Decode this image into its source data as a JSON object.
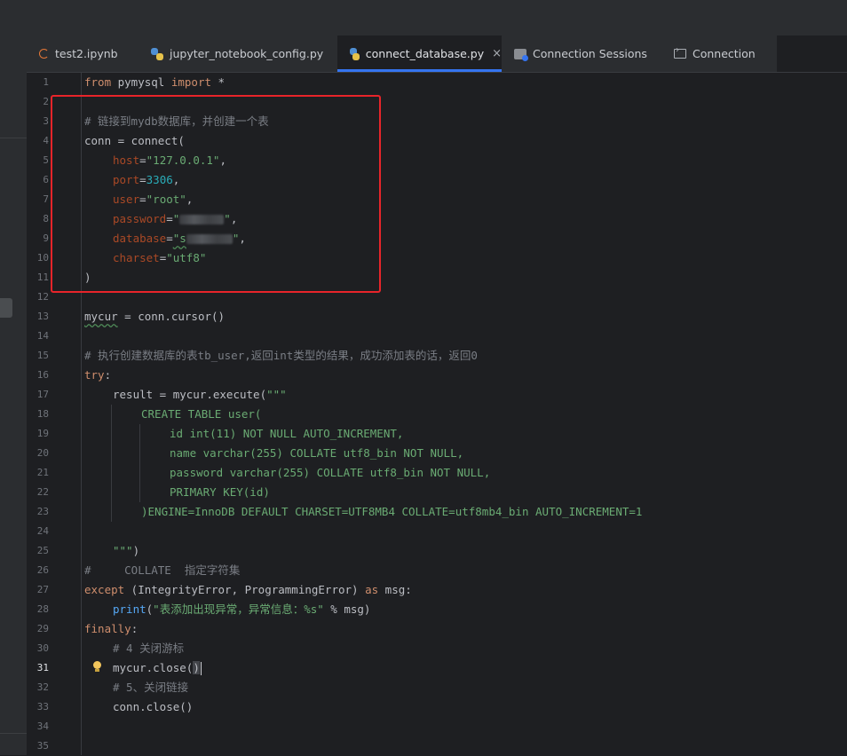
{
  "tabs": [
    {
      "label": "test2.ipynb",
      "icon": "jupyter-icon",
      "active": false
    },
    {
      "label": "jupyter_notebook_config.py",
      "icon": "python-file-icon",
      "active": false
    },
    {
      "label": "connect_database.py",
      "icon": "python-file-icon",
      "active": true,
      "close": "×"
    },
    {
      "label": "Connection Sessions",
      "icon": "sessions-icon",
      "active": false
    },
    {
      "label": "Connection",
      "icon": "console-icon",
      "active": false
    }
  ],
  "editor": {
    "current_line": 31,
    "line_numbers": [
      "1",
      "2",
      "3",
      "4",
      "5",
      "6",
      "7",
      "8",
      "9",
      "10",
      "11",
      "12",
      "13",
      "14",
      "15",
      "16",
      "17",
      "18",
      "19",
      "20",
      "21",
      "22",
      "23",
      "24",
      "25",
      "26",
      "27",
      "28",
      "29",
      "30",
      "31",
      "32",
      "33",
      "34",
      "35"
    ],
    "code": {
      "l1": {
        "t1": "from",
        "t2": " pymysql ",
        "t3": "import",
        "t4": " *"
      },
      "l3": {
        "t1": "# 链接到mydb数据库，并创建一个表"
      },
      "l4": {
        "t1": "conn = connect("
      },
      "l5": {
        "t1": "host",
        "t2": "=",
        "t3": "\"127.0.0.1\"",
        "t4": ","
      },
      "l6": {
        "t1": "port",
        "t2": "=",
        "t3": "3306",
        "t4": ","
      },
      "l7": {
        "t1": "user",
        "t2": "=",
        "t3": "\"root\"",
        "t4": ","
      },
      "l8": {
        "t1": "password",
        "t2": "=",
        "t3": "\"",
        "t4": "\"",
        "t5": ","
      },
      "l9": {
        "t1": "database",
        "t2": "=",
        "t3": "\"s",
        "t4": "\"",
        "t5": ","
      },
      "l10": {
        "t1": "charset",
        "t2": "=",
        "t3": "\"utf8\""
      },
      "l11": {
        "t1": ")"
      },
      "l13": {
        "t1": "mycur",
        "t2": " = conn.cursor()"
      },
      "l15": {
        "t1": "# 执行创建数据库的表tb_user,返回int类型的结果，成功添加表的话，返回0"
      },
      "l16": {
        "t1": "try",
        "t2": ":"
      },
      "l17": {
        "t1": "result = mycur.execute(",
        "t2": "\"\"\""
      },
      "l18": {
        "t1": "CREATE TABLE user("
      },
      "l19": {
        "t1": "id int(11) NOT NULL AUTO_INCREMENT,"
      },
      "l20": {
        "t1": "name varchar(255) COLLATE utf8_bin NOT NULL,"
      },
      "l21": {
        "t1": "password varchar(255) COLLATE utf8_bin NOT NULL,"
      },
      "l22": {
        "t1": "PRIMARY KEY(id)"
      },
      "l23": {
        "t1": ")ENGINE=InnoDB DEFAULT CHARSET=UTF8MB4 COLLATE=utf8mb4_bin AUTO_INCREMENT=1"
      },
      "l25": {
        "t1": "\"\"\"",
        "t2": ")"
      },
      "l26": {
        "t1": "#     COLLATE  指定字符集"
      },
      "l27": {
        "t1": "except",
        "t2": " (IntegrityError, ProgrammingError) ",
        "t3": "as",
        "t4": " msg:"
      },
      "l28": {
        "t1": "print",
        "t2": "(",
        "t3": "\"表添加出现异常，异常信息：%s\"",
        "t4": " % msg)"
      },
      "l29": {
        "t1": "finally",
        "t2": ":"
      },
      "l30": {
        "t1": "# 4 关闭游标"
      },
      "l31": {
        "t1": "mycur.close(",
        "t2": ")"
      },
      "l32": {
        "t1": "# 5、关闭链接"
      },
      "l33": {
        "t1": "conn.close()"
      }
    }
  },
  "colors": {
    "keyword": "#cf8e6d",
    "string": "#6aab73",
    "number": "#2aacb8",
    "parameter": "#aa4926",
    "comment": "#7a7e85",
    "annotation_box": "#e8242a",
    "active_tab_underline": "#3574f0"
  }
}
